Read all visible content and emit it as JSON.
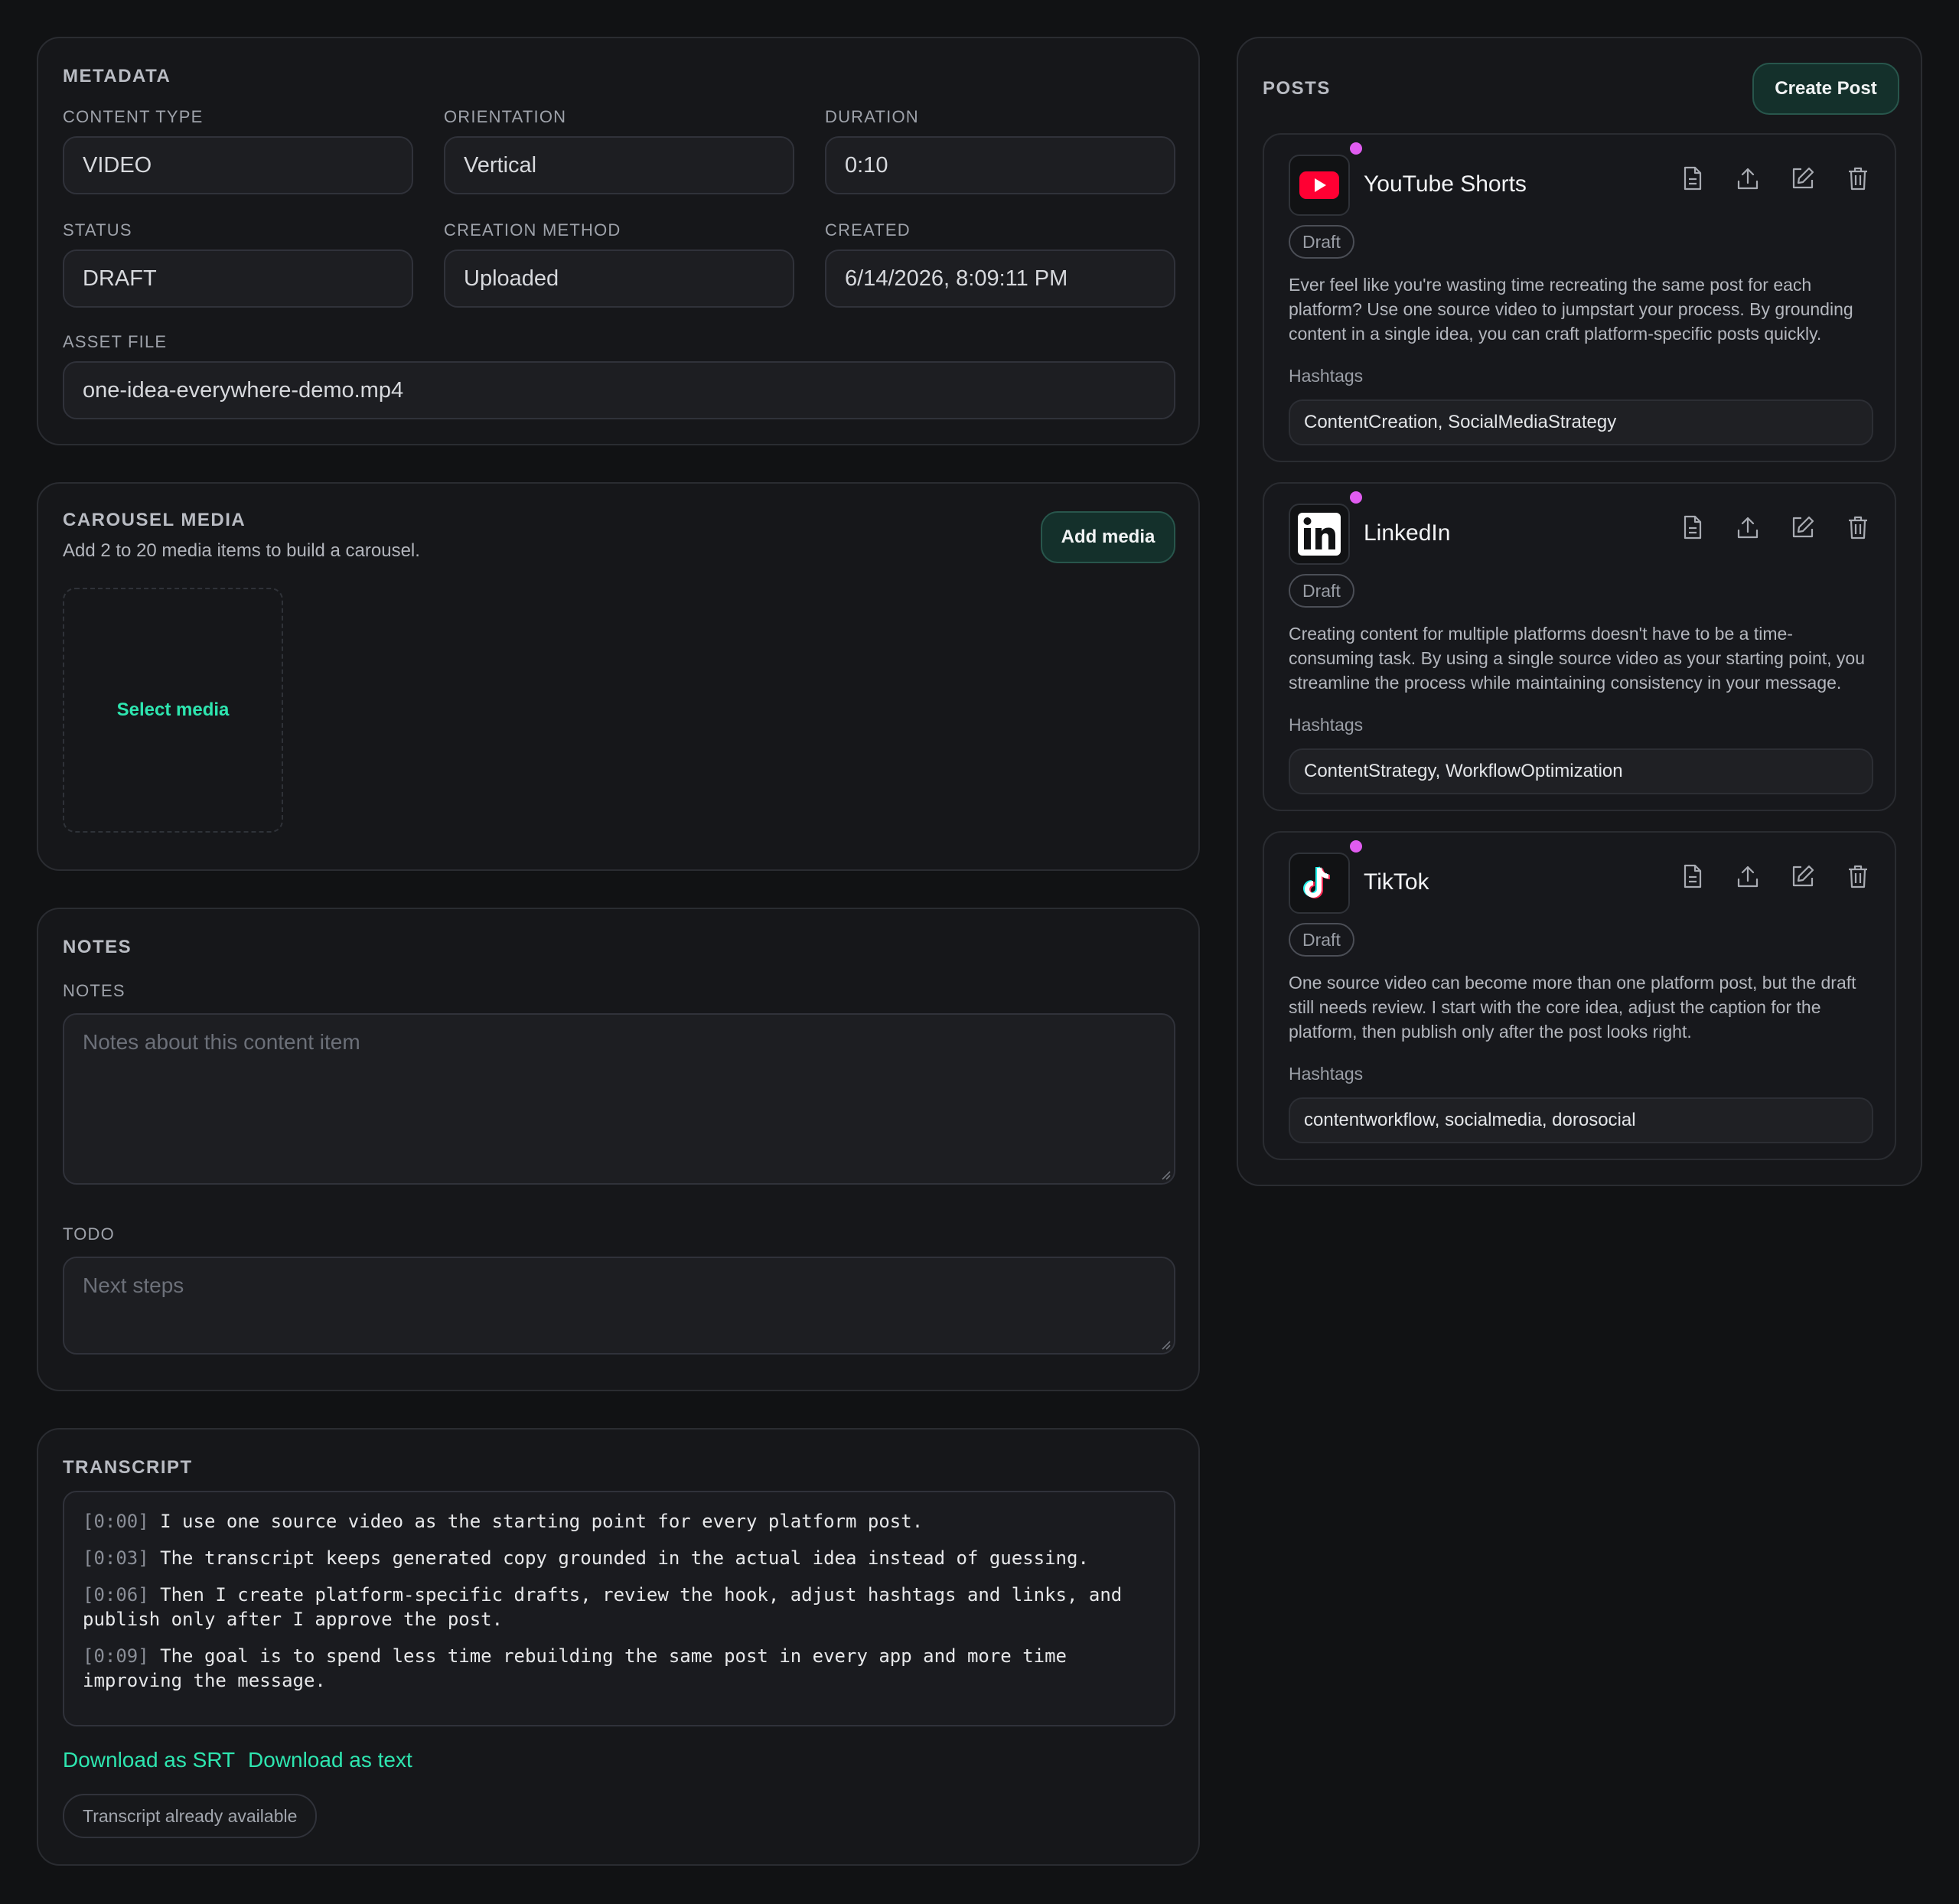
{
  "metadata": {
    "title": "METADATA",
    "content_type": {
      "label": "CONTENT TYPE",
      "value": "VIDEO"
    },
    "orientation": {
      "label": "ORIENTATION",
      "value": "Vertical"
    },
    "duration": {
      "label": "DURATION",
      "value": "0:10"
    },
    "status": {
      "label": "STATUS",
      "value": "DRAFT"
    },
    "creation_method": {
      "label": "CREATION METHOD",
      "value": "Uploaded"
    },
    "created": {
      "label": "CREATED",
      "value": "6/14/2026, 8:09:11 PM"
    },
    "asset_file": {
      "label": "ASSET FILE",
      "value": "one-idea-everywhere-demo.mp4"
    }
  },
  "carousel": {
    "title": "CAROUSEL MEDIA",
    "subtitle": "Add 2 to 20 media items to build a carousel.",
    "add_button": "Add media",
    "select_label": "Select media"
  },
  "notes": {
    "title": "NOTES",
    "notes_label": "NOTES",
    "notes_placeholder": "Notes about this content item",
    "todo_label": "TODO",
    "todo_placeholder": "Next steps"
  },
  "transcript": {
    "title": "TRANSCRIPT",
    "lines": [
      {
        "time": "[0:00]",
        "text": "I use one source video as the starting point for every platform post."
      },
      {
        "time": "[0:03]",
        "text": "The transcript keeps generated copy grounded in the actual idea instead of guessing."
      },
      {
        "time": "[0:06]",
        "text": "Then I create platform-specific drafts, review the hook, adjust hashtags and links, and publish only after I approve the post."
      },
      {
        "time": "[0:09]",
        "text": "The goal is to spend less time rebuilding the same post in every app and more time improving the message."
      }
    ],
    "download_srt": "Download as SRT",
    "download_text": "Download as text",
    "status_pill": "Transcript already available"
  },
  "posts": {
    "title": "POSTS",
    "create_button": "Create Post",
    "items": [
      {
        "platform": "YouTube Shorts",
        "icon": "youtube-icon",
        "status": "Draft",
        "body": "Ever feel like you're wasting time recreating the same post for each platform? Use one source video to jumpstart your process. By grounding content in a single idea, you can craft platform-specific posts quickly.",
        "hashtags_label": "Hashtags",
        "hashtags": "ContentCreation, SocialMediaStrategy"
      },
      {
        "platform": "LinkedIn",
        "icon": "linkedin-icon",
        "status": "Draft",
        "body": "Creating content for multiple platforms doesn't have to be a time-consuming task. By using a single source video as your starting point, you streamline the process while maintaining consistency in your message.",
        "hashtags_label": "Hashtags",
        "hashtags": "ContentStrategy, WorkflowOptimization"
      },
      {
        "platform": "TikTok",
        "icon": "tiktok-icon",
        "status": "Draft",
        "body": "One source video can become more than one platform post, but the draft still needs review. I start with the core idea, adjust the caption for the platform, then publish only after the post looks right.",
        "hashtags_label": "Hashtags",
        "hashtags": "contentworkflow, socialmedia, dorosocial"
      }
    ]
  },
  "colors": {
    "background": "#111214",
    "card": "#16171a",
    "accent": "#2ee6b0",
    "button": "#14302b",
    "status_dot": "#e05cf0",
    "youtube_red": "#ff0033"
  }
}
